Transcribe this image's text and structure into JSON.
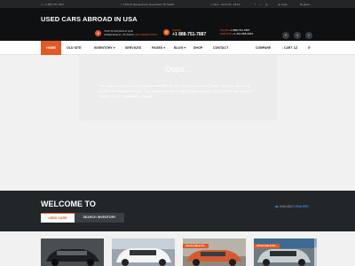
{
  "topbar": {
    "phone": "+1 888 751 7887",
    "address": "7300 W Mangold Ave Greenfield, WI 53220",
    "hours": "Mon - Sat 9:00 - 18:00",
    "login": "Login",
    "register": "Register"
  },
  "header": {
    "brand": "USED CARS ABROAD IN USA",
    "address_line1": "7300 W MANGOLD AVE",
    "address_line2": "GREENFIELD, WI 53220",
    "address_link": "GET DIRECTIONS",
    "sales_label": "SALES",
    "sales_phone": "+1 888-751-7887",
    "contact": {
      "line1_label": "SALES",
      "line1_value": "+1 888-751-7887",
      "line2_label": "SERVICE",
      "line2_value": "+1 410-868-0003"
    },
    "social": [
      "f",
      "t",
      "i"
    ]
  },
  "nav": {
    "items": [
      "HOME",
      "OLD SITE",
      "INVENTORY ▾",
      "SERVICES",
      "PAGES ▾",
      "BLOG ▾",
      "SHOP",
      "CONTACT"
    ],
    "compare": "COMPARE",
    "cart": "CART"
  },
  "error": {
    "title": "Oops...",
    "text": "This page can't load Google Maps correctly. Do you own this website? Please see the JavaScript console for technical details. The page can't load Google Maps correctly. Do you own this website? Please see the JavaScript console."
  },
  "welcome": {
    "title": "WELCOME TO",
    "tab_used": "USED CARS",
    "tab_search": "SEARCH INVENTORY",
    "available": "AVAILABLE",
    "available_link": "DEALERS"
  },
  "cards": [
    {
      "ribbon": ""
    },
    {
      "ribbon": ""
    },
    {
      "ribbon": "AVAILABLE IN..."
    },
    {
      "ribbon": ""
    },
    {
      "ribbon": "AVAILABLE IN..."
    }
  ],
  "colors": {
    "accent": "#e05a28",
    "dark": "#0f1011",
    "link": "#2d8ee0"
  }
}
